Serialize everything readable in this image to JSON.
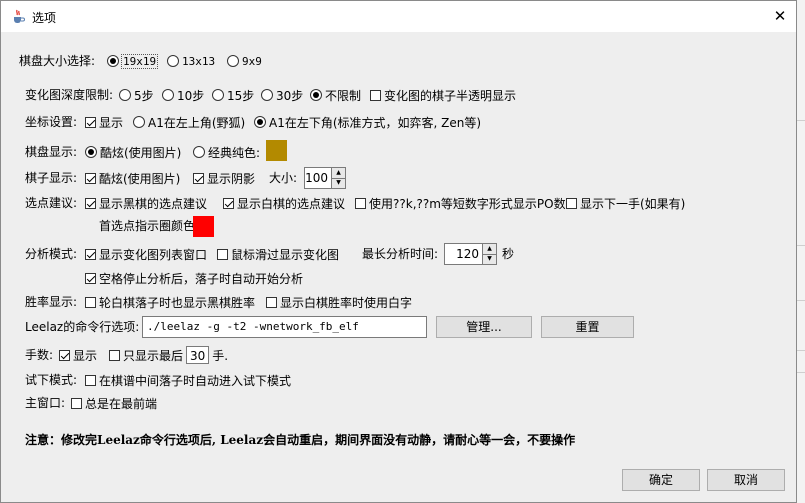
{
  "window": {
    "title": "选项",
    "close_glyph": "✕"
  },
  "board_size": {
    "label": "棋盘大小选择:",
    "options": [
      "19x19",
      "13x13",
      "9x9"
    ],
    "selected": "19x19"
  },
  "depth": {
    "label": "变化图深度限制:",
    "options": [
      "5步",
      "10步",
      "15步",
      "30步",
      "不限制"
    ],
    "selected": "不限制",
    "translucent_label": "变化图的棋子半透明显示",
    "translucent_checked": false
  },
  "coords": {
    "label": "坐标设置:",
    "show_label": "显示",
    "show_checked": true,
    "top_left_label": "A1在左上角(野狐)",
    "bottom_left_label": "A1在左下角(标准方式，如弈客, Zen等)",
    "selected": "A1在左下角(标准方式，如弈客, Zen等)"
  },
  "board_display": {
    "label": "棋盘显示:",
    "fancy_label": "酷炫(使用图片)",
    "classic_label": "经典纯色:",
    "selected": "酷炫(使用图片)",
    "classic_color": "#b38a00"
  },
  "stone_display": {
    "label": "棋子显示:",
    "fancy_label": "酷炫(使用图片)",
    "fancy_checked": true,
    "shadow_label": "显示阴影",
    "shadow_checked": true,
    "size_label": "大小:",
    "size_value": "100"
  },
  "suggestion": {
    "label": "选点建议:",
    "black_label": "显示黑棋的选点建议",
    "black_checked": true,
    "white_label": "显示白棋的选点建议",
    "white_checked": true,
    "short_label": "使用??k,??m等短数字形式显示PO数",
    "short_checked": false,
    "next_label": "显示下一手(如果有)",
    "next_checked": false,
    "ring_label": "首选点指示圈颜色:",
    "ring_color": "#ff0000"
  },
  "analysis": {
    "label": "分析模式:",
    "list_label": "显示变化图列表窗口",
    "list_checked": true,
    "hover_label": "鼠标滑过显示变化图",
    "hover_checked": false,
    "max_time_label": "最长分析时间:",
    "max_time_value": "120",
    "seconds_label": "秒",
    "space_label": "空格停止分析后，落子时自动开始分析",
    "space_checked": true
  },
  "winrate": {
    "label": "胜率显示:",
    "white_turn_label": "轮白棋落子时也显示黑棋胜率",
    "white_turn_checked": false,
    "white_text_label": "显示白棋胜率时使用白字",
    "white_text_checked": false
  },
  "leelaz": {
    "label": "Leelaz的命令行选项:",
    "value": "./leelaz -g -t2 -wnetwork_fb_elf",
    "manage_label": "管理...",
    "reset_label": "重置"
  },
  "move_number": {
    "label": "手数:",
    "show_label": "显示",
    "show_checked": true,
    "last_label": "只显示最后",
    "last_checked": false,
    "last_value": "30",
    "unit": "手."
  },
  "try_mode": {
    "label": "试下模式:",
    "auto_label": "在棋谱中间落子时自动进入试下模式",
    "auto_checked": false
  },
  "main_window": {
    "label": "主窗口:",
    "top_label": "总是在最前端",
    "top_checked": false
  },
  "note": "注意：修改完Leelaz命令行选项后, Leelaz会自动重启，期间界面没有动静，请耐心等一会，不要操作",
  "buttons": {
    "ok": "确定",
    "cancel": "取消"
  }
}
